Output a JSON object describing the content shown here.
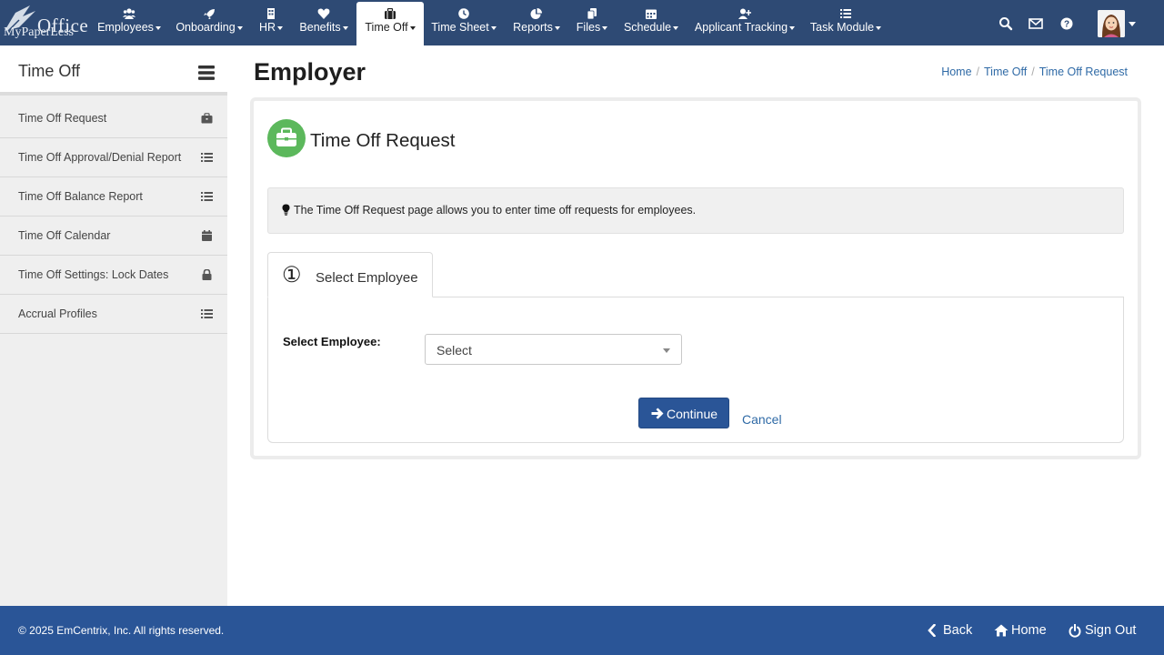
{
  "brand": {
    "logo_text_top": "Office",
    "logo_text_bottom": "MyPaperLess"
  },
  "nav": {
    "items": [
      {
        "label": "Employees",
        "icon": "users-icon"
      },
      {
        "label": "Onboarding",
        "icon": "rocket-icon"
      },
      {
        "label": "HR",
        "icon": "building-icon"
      },
      {
        "label": "Benefits",
        "icon": "heart-icon"
      },
      {
        "label": "Time Off",
        "icon": "suitcase-icon",
        "active": true
      },
      {
        "label": "Time Sheet",
        "icon": "clock-icon"
      },
      {
        "label": "Reports",
        "icon": "pie-chart-icon"
      },
      {
        "label": "Files",
        "icon": "files-icon"
      },
      {
        "label": "Schedule",
        "icon": "calendar-icon"
      },
      {
        "label": "Applicant Tracking",
        "icon": "user-plus-icon"
      },
      {
        "label": "Task Module",
        "icon": "tasks-icon"
      }
    ],
    "right_icons": [
      "search-icon",
      "envelope-icon",
      "help-icon"
    ],
    "avatar": "user-avatar"
  },
  "sidebar": {
    "title": "Time Off",
    "items": [
      {
        "label": "Time Off Request",
        "icon": "briefcase-icon"
      },
      {
        "label": "Time Off Approval/Denial Report",
        "icon": "list-icon"
      },
      {
        "label": "Time Off Balance Report",
        "icon": "list-icon"
      },
      {
        "label": "Time Off Calendar",
        "icon": "calendar-icon"
      },
      {
        "label": "Time Off Settings: Lock Dates",
        "icon": "lock-icon"
      },
      {
        "label": "Accrual Profiles",
        "icon": "list-icon"
      }
    ]
  },
  "page": {
    "title": "Employer",
    "breadcrumb": [
      "Home",
      "Time Off",
      "Time Off Request"
    ]
  },
  "request": {
    "title": "Time Off Request",
    "info": "The Time Off Request page allows you to enter time off requests for employees.",
    "step_number": "①",
    "step_label": "Select Employee",
    "field_label": "Select Employee:",
    "select_value": "Select",
    "continue_label": "Continue",
    "cancel_label": "Cancel"
  },
  "footer": {
    "copyright": "© 2025 EmCentrix, Inc. All rights reserved.",
    "back": "Back",
    "home": "Home",
    "signout": "Sign Out"
  },
  "colors": {
    "nav_bg": "#2e4a74",
    "footer_bg": "#2a5597",
    "primary_button": "#2a5597",
    "success_icon": "#5cb85c",
    "link": "#2f6aa6"
  }
}
